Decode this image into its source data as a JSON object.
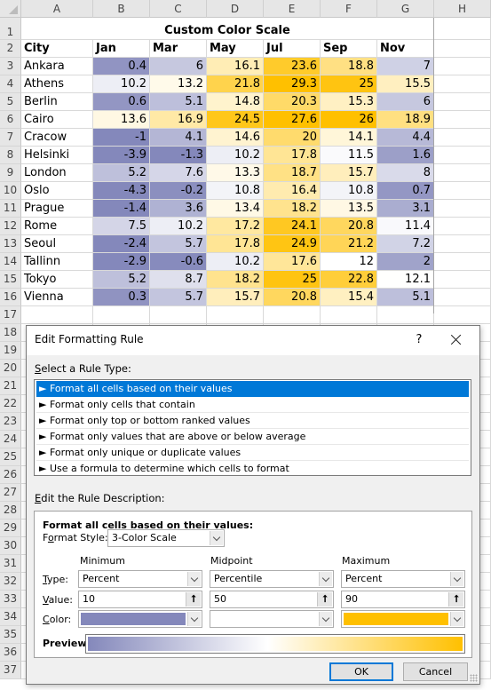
{
  "sheet": {
    "column_headers": [
      "A",
      "B",
      "C",
      "D",
      "E",
      "F",
      "G",
      "H"
    ],
    "row_numbers": [
      "1",
      "2",
      "3",
      "4",
      "5",
      "6",
      "7",
      "8",
      "9",
      "10",
      "11",
      "12",
      "13",
      "14",
      "15",
      "16",
      "17",
      "18",
      "19",
      "20",
      "21",
      "22",
      "23",
      "24",
      "25",
      "26",
      "27",
      "28",
      "29",
      "30",
      "31",
      "32",
      "33",
      "34",
      "35",
      "36",
      "37"
    ],
    "title": "Custom Color Scale",
    "table_headers": [
      "City",
      "Jan",
      "Mar",
      "May",
      "Jul",
      "Sep",
      "Nov"
    ],
    "rows": [
      {
        "city": "Ankara",
        "values": [
          "0.4",
          "6",
          "16.1",
          "23.6",
          "18.8",
          "7"
        ]
      },
      {
        "city": "Athens",
        "values": [
          "10.2",
          "13.2",
          "21.8",
          "29.3",
          "25",
          "15.5"
        ]
      },
      {
        "city": "Berlin",
        "values": [
          "0.6",
          "5.1",
          "14.8",
          "20.3",
          "15.3",
          "6"
        ]
      },
      {
        "city": "Cairo",
        "values": [
          "13.6",
          "16.9",
          "24.5",
          "27.6",
          "26",
          "18.9"
        ]
      },
      {
        "city": "Cracow",
        "values": [
          "-1",
          "4.1",
          "14.6",
          "20",
          "14.1",
          "4.4"
        ]
      },
      {
        "city": "Helsinki",
        "values": [
          "-3.9",
          "-1.3",
          "10.2",
          "17.8",
          "11.5",
          "1.6"
        ]
      },
      {
        "city": "London",
        "values": [
          "5.2",
          "7.6",
          "13.3",
          "18.7",
          "15.7",
          "8"
        ]
      },
      {
        "city": "Oslo",
        "values": [
          "-4.3",
          "-0.2",
          "10.8",
          "16.4",
          "10.8",
          "0.7"
        ]
      },
      {
        "city": "Prague",
        "values": [
          "-1.4",
          "3.6",
          "13.4",
          "18.2",
          "13.5",
          "3.1"
        ]
      },
      {
        "city": "Rome",
        "values": [
          "7.5",
          "10.2",
          "17.2",
          "24.1",
          "20.8",
          "11.4"
        ]
      },
      {
        "city": "Seoul",
        "values": [
          "-2.4",
          "5.7",
          "17.8",
          "24.9",
          "21.2",
          "7.2"
        ]
      },
      {
        "city": "Tallinn",
        "values": [
          "-2.9",
          "-0.6",
          "10.2",
          "17.6",
          "12",
          "2"
        ]
      },
      {
        "city": "Tokyo",
        "values": [
          "5.2",
          "8.7",
          "18.2",
          "25",
          "22.8",
          "12.1"
        ]
      },
      {
        "city": "Vienna",
        "values": [
          "0.3",
          "5.7",
          "15.7",
          "20.8",
          "15.4",
          "5.1"
        ]
      }
    ]
  },
  "color_scale": {
    "min_color": "#8488bb",
    "mid_color": "#ffffff",
    "max_color": "#ffc000"
  },
  "dialog": {
    "title": "Edit Formatting Rule",
    "help_label": "?",
    "select_rule_type_label_accel": "S",
    "select_rule_type_label_rest": "elect a Rule Type:",
    "rule_types": [
      "► Format all cells based on their values",
      "► Format only cells that contain",
      "► Format only top or bottom ranked values",
      "► Format only values that are above or below average",
      "► Format only unique or duplicate values",
      "► Use a formula to determine which cells to format"
    ],
    "selected_rule_index": 0,
    "edit_description_label_accel": "E",
    "edit_description_label_rest": "dit the Rule Description:",
    "description_heading": "Format all cells based on their values:",
    "format_style_label_pre": "F",
    "format_style_label_accel": "o",
    "format_style_label_rest": "rmat Style:",
    "format_style_value": "3-Color Scale",
    "columns": {
      "minimum": {
        "label": "Minimum",
        "type": "Percent",
        "value": "10",
        "color": "#8488bb"
      },
      "midpoint": {
        "label": "Midpoint",
        "type": "Percentile",
        "value": "50",
        "color": "#ffffff"
      },
      "maximum": {
        "label": "Maximum",
        "type": "Percent",
        "value": "90",
        "color": "#ffc000"
      }
    },
    "type_label_accel": "T",
    "type_label_rest": "ype:",
    "value_label_accel": "V",
    "value_label_rest": "alue:",
    "color_label_accel": "C",
    "color_label_rest": "olor:",
    "preview_label": "Preview:",
    "ref_button_glyph": "🠕",
    "ok_label": "OK",
    "cancel_label": "Cancel"
  }
}
